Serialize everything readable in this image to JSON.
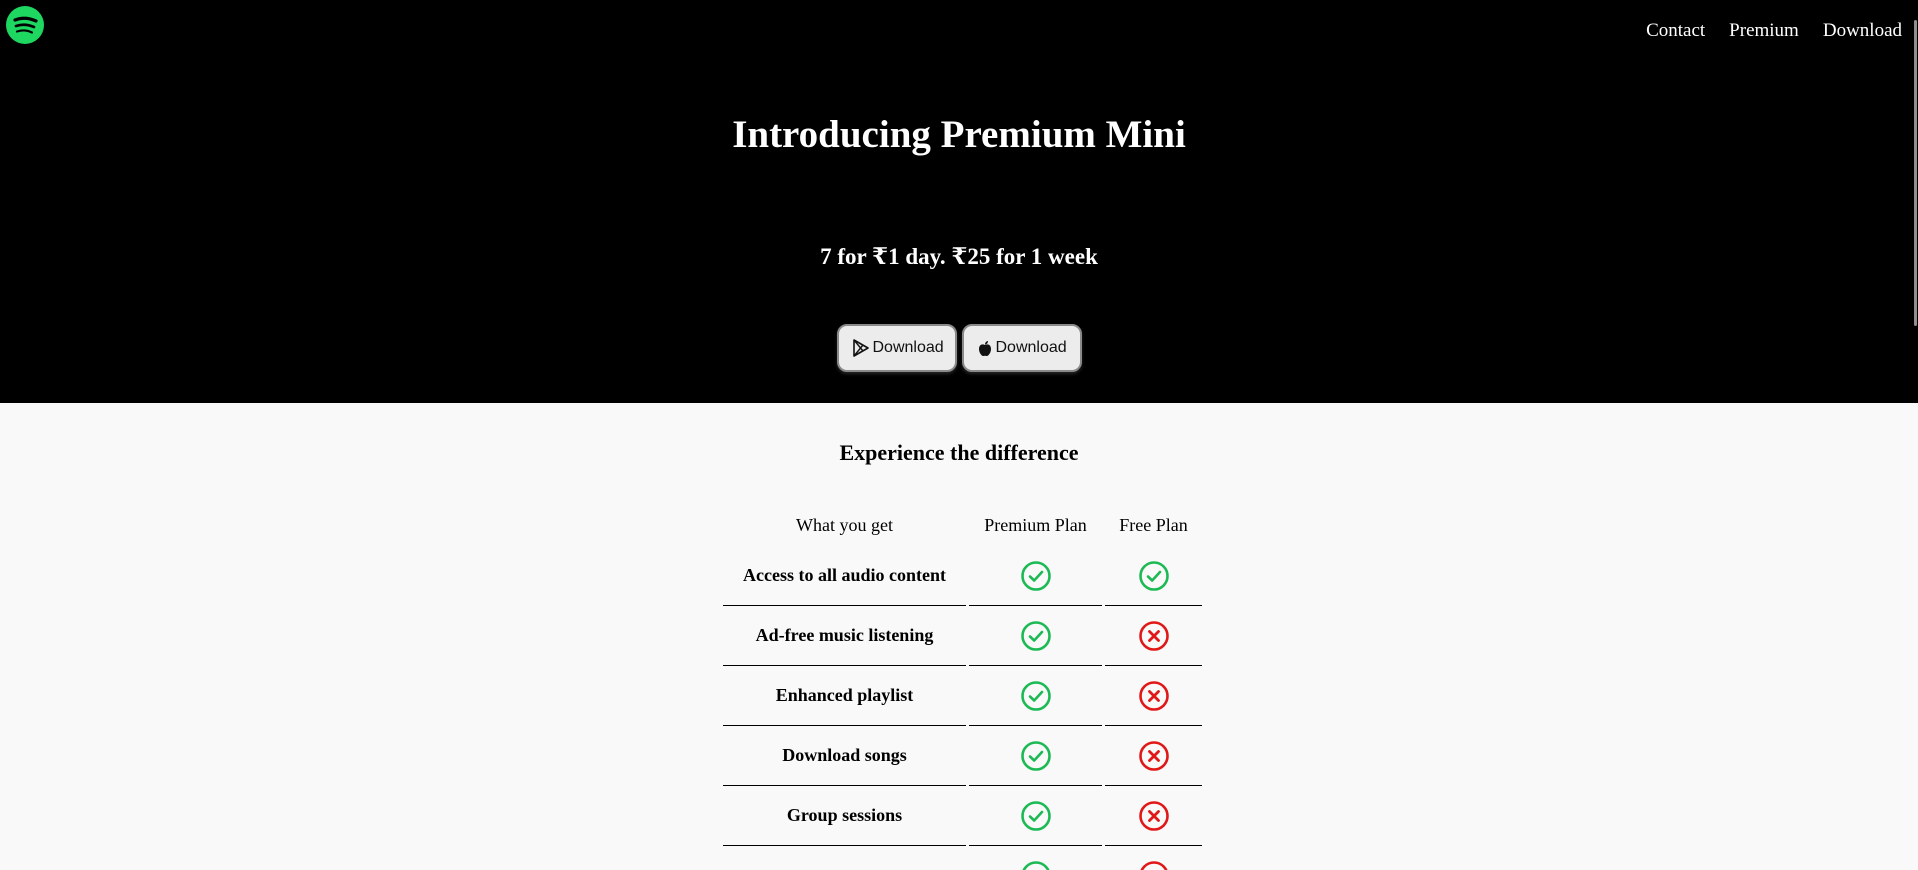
{
  "nav": {
    "logo_icon": "spotify-logo-icon",
    "items": [
      {
        "label": "Contact"
      },
      {
        "label": "Premium"
      },
      {
        "label": "Download"
      }
    ]
  },
  "hero": {
    "title": "Introducing Premium Mini",
    "subtitle": "7 for ₹1 day. ₹25 for 1 week",
    "buttons": [
      {
        "label": "Download",
        "icon": "google-play-icon"
      },
      {
        "label": "Download",
        "icon": "apple-icon"
      }
    ]
  },
  "compare": {
    "title": "Experience the difference",
    "headers": {
      "feature": "What you get",
      "premium": "Premium Plan",
      "free": "Free Plan"
    },
    "rows": [
      {
        "feature": "Access to all audio content",
        "premium": true,
        "free": true
      },
      {
        "feature": "Ad-free music listening",
        "premium": true,
        "free": false
      },
      {
        "feature": "Enhanced playlist",
        "premium": true,
        "free": false
      },
      {
        "feature": "Download songs",
        "premium": true,
        "free": false
      },
      {
        "feature": "Group sessions",
        "premium": true,
        "free": false
      },
      {
        "feature": "",
        "premium": true,
        "free": false
      }
    ]
  },
  "colors": {
    "hero_bg": "#000000",
    "brand_green": "#1ed760",
    "check_green": "#1db954",
    "cross_red": "#e01818",
    "page_bg": "#f9f9f9"
  }
}
